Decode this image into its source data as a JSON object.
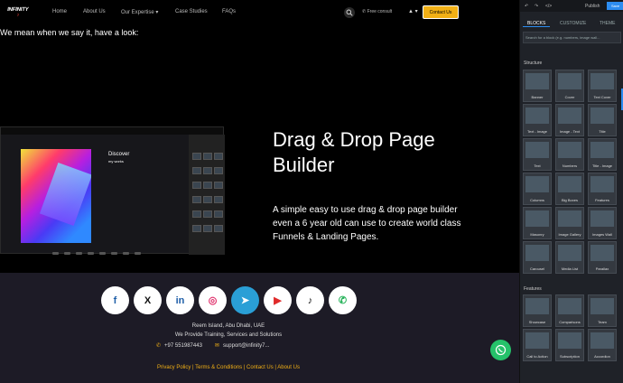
{
  "site": {
    "nav": {
      "logo_text_1": "INFINITY",
      "logo_text_2": "7",
      "links": [
        "Home",
        "About Us",
        "Our Expertise ▾",
        "Case Studies",
        "FAQs"
      ],
      "phone": "Free consult",
      "user": "▲ ▾",
      "contact_label": "Contact Us"
    },
    "intro": "We mean when we say it, have a look:",
    "demo": {
      "discover_title": "Discover",
      "discover_sub": "my works"
    },
    "hero_title": "Drag & Drop Page Builder",
    "hero_desc": "A simple easy to use drag & drop page builder even a 6 year old can use to create world class Funnels & Landing Pages."
  },
  "footer": {
    "socials": [
      {
        "name": "facebook",
        "glyph": "f",
        "color": "#1f5fa8"
      },
      {
        "name": "x",
        "glyph": "X",
        "color": "#111111"
      },
      {
        "name": "linkedin",
        "glyph": "in",
        "color": "#1f5fa8"
      },
      {
        "name": "instagram",
        "glyph": "◎",
        "color": "#e0306b"
      },
      {
        "name": "telegram",
        "glyph": "➤",
        "color": "#ffffff"
      },
      {
        "name": "youtube",
        "glyph": "▶",
        "color": "#e02a2a"
      },
      {
        "name": "tiktok",
        "glyph": "♪",
        "color": "#111111"
      },
      {
        "name": "whatsapp",
        "glyph": "✆",
        "color": "#27b35a"
      }
    ],
    "address": "Reem Island, Abu Dhabi, UAE",
    "tagline": "We Provide Training, Services and Solutions",
    "phone": "+97 551987443",
    "email": "support@infinity7...",
    "links": "Privacy Policy | Terms & Conditions | Contact Us | About Us"
  },
  "panel": {
    "top": {
      "code": "</>",
      "undo": "↶",
      "redo": "↷",
      "publish": "Publish",
      "save": "Save"
    },
    "tabs": [
      "BLOCKS",
      "CUSTOMIZE",
      "THEME"
    ],
    "search_placeholder": "Search for a block (e.g. numbers, image wall...",
    "section_1": "Structure",
    "tiles_1": [
      "Banner",
      "Cover",
      "Text Cover",
      "Text - Image",
      "Image - Text",
      "Title",
      "Text",
      "Numbers",
      "Title - Image",
      "Columns",
      "Big Boxes",
      "Features",
      "Masonry",
      "Image Gallery",
      "Images Wall",
      "Carousel",
      "Media List",
      "Parallax"
    ],
    "section_2": "Features",
    "tiles_2": [
      "Showcase",
      "Comparisons",
      "Team",
      "Call to Action",
      "Subscription",
      "Accordion"
    ]
  },
  "colors": {
    "accent_yellow": "#f2b015",
    "panel_blue": "#2c8cf0",
    "whatsapp_green": "#25c26a"
  }
}
